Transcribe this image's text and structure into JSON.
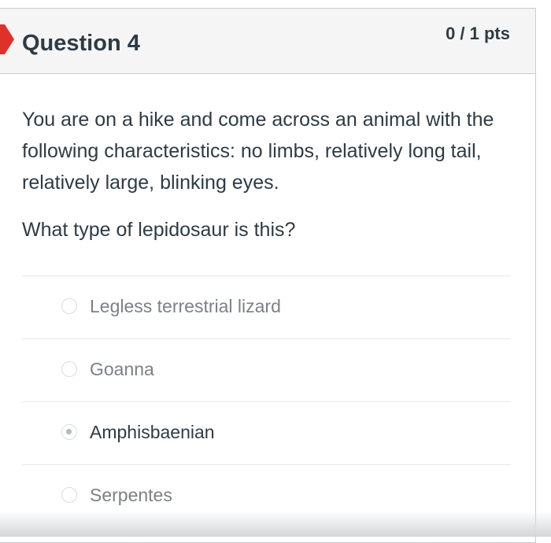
{
  "question": {
    "title": "Question 4",
    "points": "0 / 1 pts",
    "text": "You are on a hike and come across an animal with the following characteristics: no limbs, relatively long tail, relatively large, blinking eyes.",
    "prompt": "What type of lepidosaur is this?",
    "flag_color": "#e0302a",
    "answers": [
      {
        "label": "Legless terrestrial lizard",
        "selected": false
      },
      {
        "label": "Goanna",
        "selected": false
      },
      {
        "label": "Amphisbaenian",
        "selected": true
      },
      {
        "label": "Serpentes",
        "selected": false
      }
    ]
  }
}
